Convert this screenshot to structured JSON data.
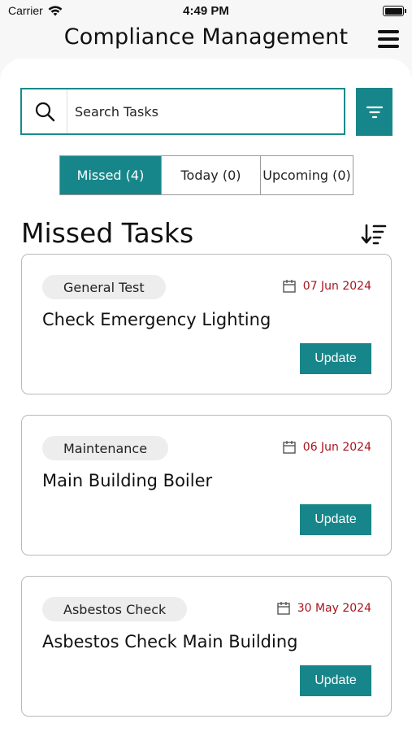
{
  "status_bar": {
    "carrier": "Carrier",
    "time": "4:49 PM"
  },
  "header": {
    "title": "Compliance Management",
    "menu_icon": "hamburger-menu-icon"
  },
  "search": {
    "placeholder": "Search Tasks",
    "value": "",
    "filter_icon": "filter-icon"
  },
  "tabs": [
    {
      "label": "Missed (4)",
      "active": true
    },
    {
      "label": "Today (0)",
      "active": false
    },
    {
      "label": "Upcoming (0)",
      "active": false
    }
  ],
  "section": {
    "title": "Missed Tasks",
    "sort_icon": "sort-descending-icon"
  },
  "tasks": [
    {
      "category": "General Test",
      "date": "07 Jun 2024",
      "title": "Check Emergency Lighting",
      "action": "Update"
    },
    {
      "category": "Maintenance",
      "date": "06 Jun 2024",
      "title": "Main Building Boiler",
      "action": "Update"
    },
    {
      "category": "Asbestos Check",
      "date": "30 May 2024",
      "title": "Asbestos Check Main Building",
      "action": "Update"
    }
  ],
  "colors": {
    "accent": "#17868a",
    "date_overdue": "#a8141e",
    "chip_bg": "#ededed"
  }
}
